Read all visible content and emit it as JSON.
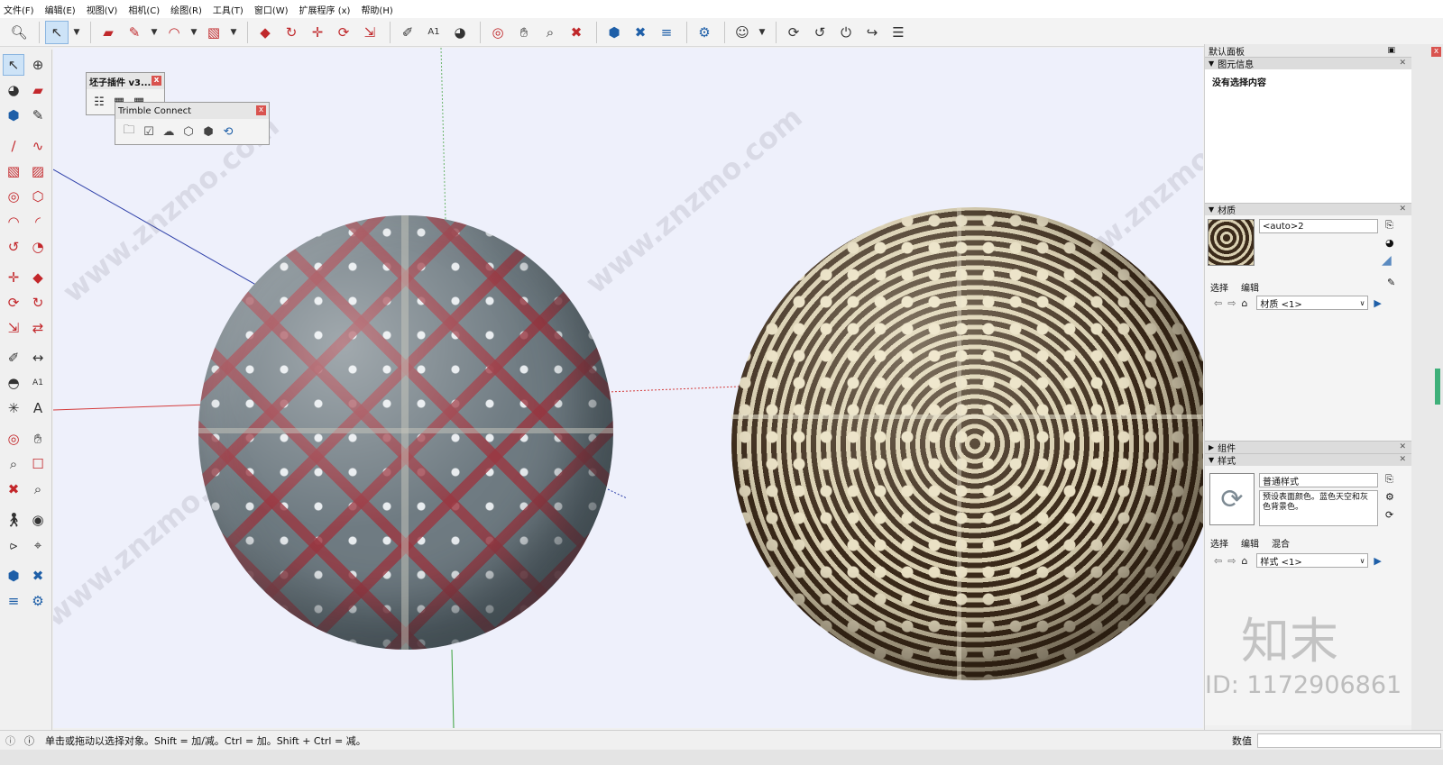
{
  "menu": [
    "文件(F)",
    "编辑(E)",
    "视图(V)",
    "相机(C)",
    "绘图(R)",
    "工具(T)",
    "窗口(W)",
    "扩展程序 (x)",
    "帮助(H)"
  ],
  "float_windows": {
    "plugin_title": "坯子插件 v3....",
    "trimble_title": "Trimble Connect"
  },
  "panel": {
    "title": "默认面板",
    "entity_info": {
      "header": "图元信息",
      "content": "没有选择内容"
    },
    "materials": {
      "header": "材质",
      "name_value": "<auto>2",
      "tabs": [
        "选择",
        "编辑"
      ],
      "dropdown": "材质 <1>"
    },
    "components": {
      "header": "组件"
    },
    "styles": {
      "header": "样式",
      "name_value": "普通样式",
      "description": "预设表面颜色。蓝色天空和灰色背景色。",
      "tabs": [
        "选择",
        "编辑",
        "混合"
      ],
      "dropdown": "样式 <1>"
    }
  },
  "status": {
    "hint": "单击或拖动以选择对象。Shift = 加/减。Ctrl = 加。Shift + Ctrl = 减。",
    "vcb_label": "数值"
  },
  "watermarks": {
    "site": "www.znzmo.com",
    "brand": "知末",
    "id": "ID: 1172906861"
  }
}
